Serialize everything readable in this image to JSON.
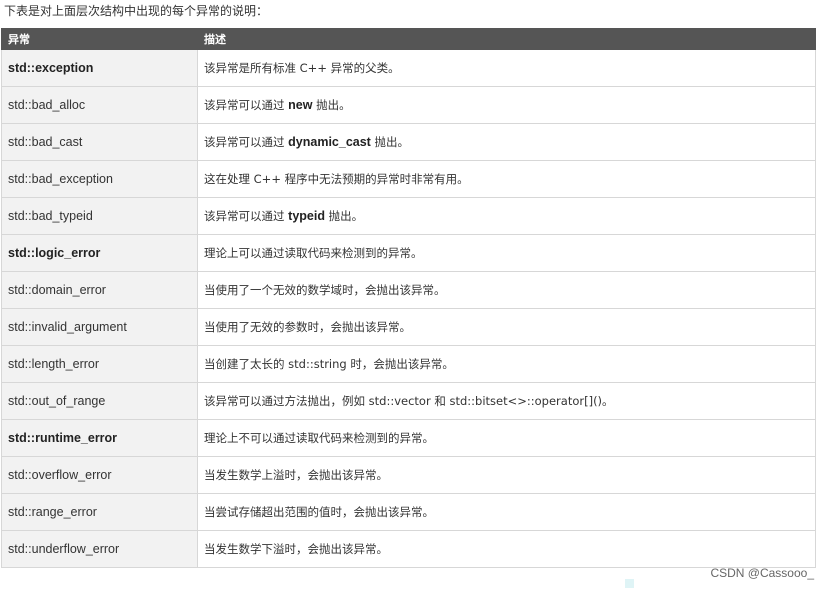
{
  "intro": "下表是对上面层次结构中出现的每个异常的说明：",
  "table": {
    "headers": [
      "异常",
      "描述"
    ],
    "rows": [
      {
        "name": "std::exception",
        "bold": true,
        "desc_pre": "该异常是所有标准 C++ 异常的父类。",
        "kw": "",
        "desc_post": ""
      },
      {
        "name": "std::bad_alloc",
        "bold": false,
        "desc_pre": "该异常可以通过 ",
        "kw": "new",
        "desc_post": " 抛出。"
      },
      {
        "name": "std::bad_cast",
        "bold": false,
        "desc_pre": "该异常可以通过 ",
        "kw": "dynamic_cast",
        "desc_post": " 抛出。"
      },
      {
        "name": "std::bad_exception",
        "bold": false,
        "desc_pre": "这在处理 C++ 程序中无法预期的异常时非常有用。",
        "kw": "",
        "desc_post": ""
      },
      {
        "name": "std::bad_typeid",
        "bold": false,
        "desc_pre": "该异常可以通过 ",
        "kw": "typeid",
        "desc_post": " 抛出。"
      },
      {
        "name": "std::logic_error",
        "bold": true,
        "desc_pre": "理论上可以通过读取代码来检测到的异常。",
        "kw": "",
        "desc_post": ""
      },
      {
        "name": "std::domain_error",
        "bold": false,
        "desc_pre": "当使用了一个无效的数学域时，会抛出该异常。",
        "kw": "",
        "desc_post": ""
      },
      {
        "name": "std::invalid_argument",
        "bold": false,
        "desc_pre": "当使用了无效的参数时，会抛出该异常。",
        "kw": "",
        "desc_post": ""
      },
      {
        "name": "std::length_error",
        "bold": false,
        "desc_pre": "当创建了太长的 std::string 时，会抛出该异常。",
        "kw": "",
        "desc_post": ""
      },
      {
        "name": "std::out_of_range",
        "bold": false,
        "desc_pre": "该异常可以通过方法抛出，例如 std::vector 和 std::bitset<>::operator[]()。",
        "kw": "",
        "desc_post": ""
      },
      {
        "name": "std::runtime_error",
        "bold": true,
        "desc_pre": "理论上不可以通过读取代码来检测到的异常。",
        "kw": "",
        "desc_post": ""
      },
      {
        "name": "std::overflow_error",
        "bold": false,
        "desc_pre": "当发生数学上溢时，会抛出该异常。",
        "kw": "",
        "desc_post": ""
      },
      {
        "name": "std::range_error",
        "bold": false,
        "desc_pre": "当尝试存储超出范围的值时，会抛出该异常。",
        "kw": "",
        "desc_post": ""
      },
      {
        "name": "std::underflow_error",
        "bold": false,
        "desc_pre": "当发生数学下溢时，会抛出该异常。",
        "kw": "",
        "desc_post": ""
      }
    ]
  },
  "watermark": "CSDN @Cassooo_"
}
